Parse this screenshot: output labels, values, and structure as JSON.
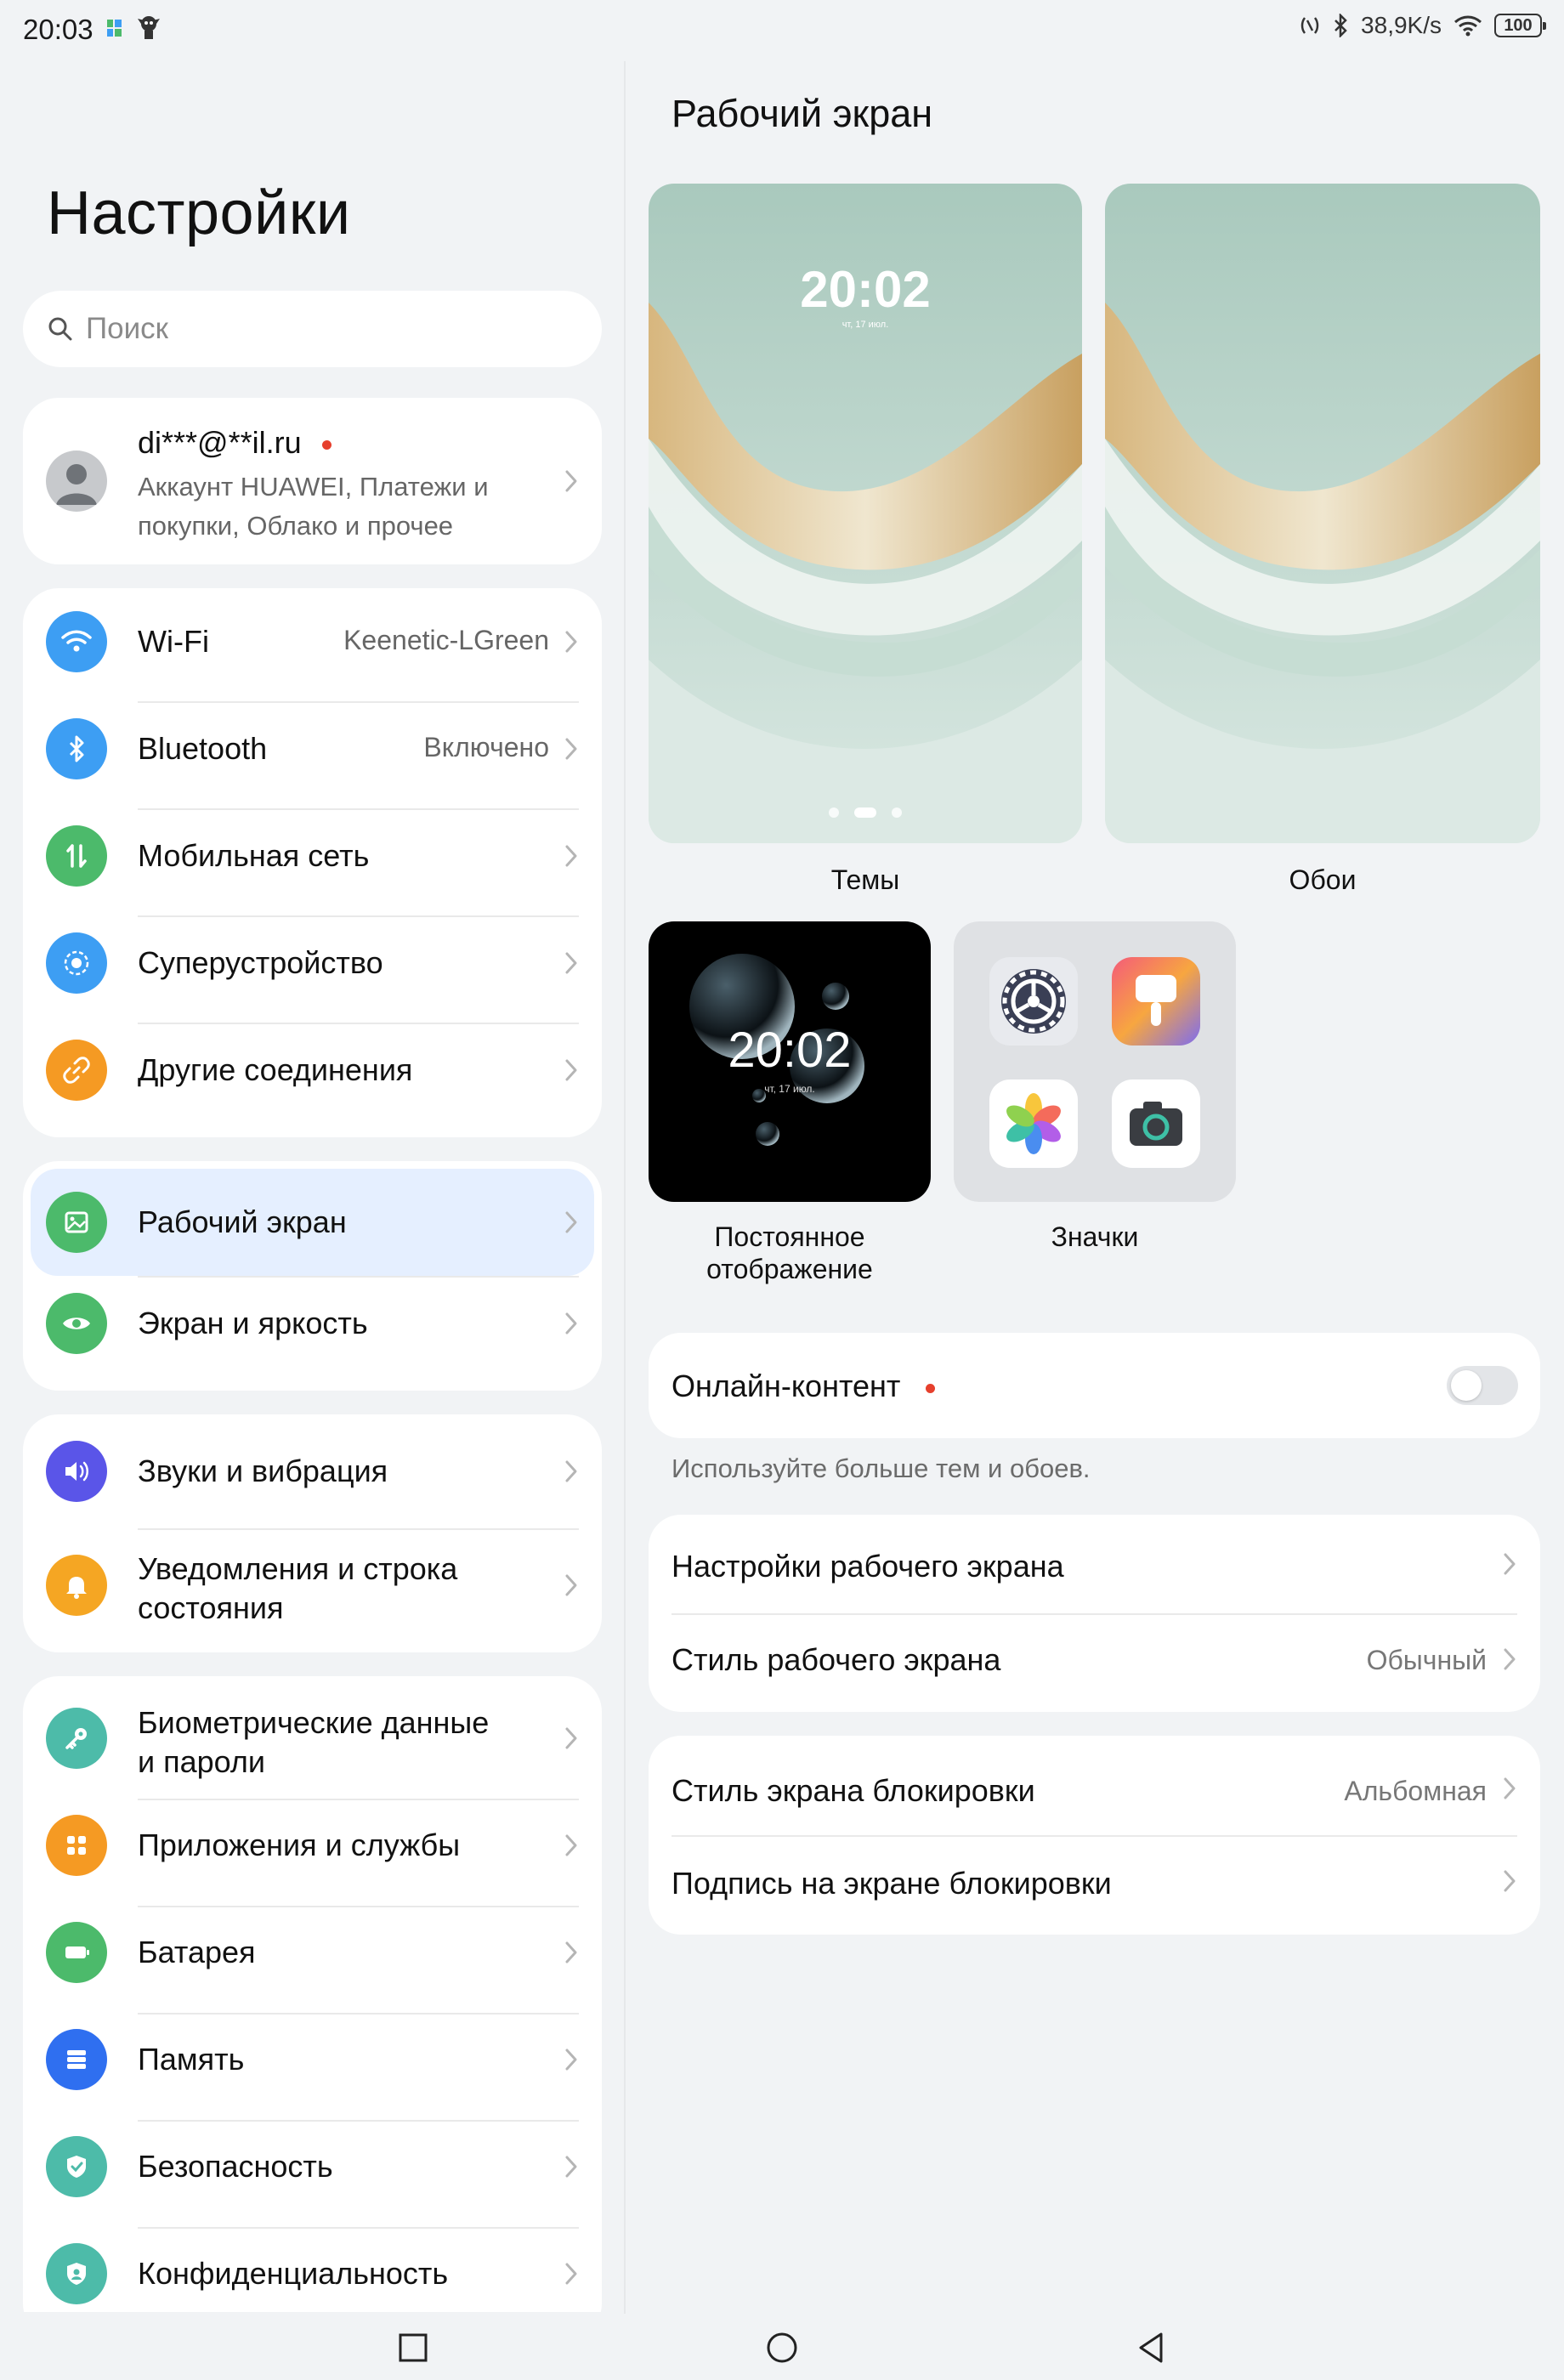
{
  "status_bar": {
    "time": "20:03",
    "net_speed": "38,9K/s",
    "battery": "100"
  },
  "left": {
    "title": "Настройки",
    "search_placeholder": "Поиск",
    "account": {
      "email": "di***@**il.ru",
      "subtitle": "Аккаунт HUAWEI, Платежи и покупки, Облако и прочее"
    },
    "group_connections": [
      {
        "label": "Wi-Fi",
        "value": "Keenetic-LGreen",
        "icon": "wifi-icon",
        "color": "#3d9ef3"
      },
      {
        "label": "Bluetooth",
        "value": "Включено",
        "icon": "bluetooth-icon",
        "color": "#3d9ef3"
      },
      {
        "label": "Мобильная сеть",
        "value": "",
        "icon": "mobile-network-icon",
        "color": "#4cba6b"
      },
      {
        "label": "Суперустройство",
        "value": "",
        "icon": "super-device-icon",
        "color": "#3d9ef3"
      },
      {
        "label": "Другие соединения",
        "value": "",
        "icon": "link-icon",
        "color": "#f59a23"
      }
    ],
    "group_display": [
      {
        "label": "Рабочий экран",
        "icon": "home-screen-icon",
        "color": "#4cba6b",
        "selected": true
      },
      {
        "label": "Экран и яркость",
        "icon": "eye-icon",
        "color": "#4cba6b",
        "selected": false
      }
    ],
    "group_sound": [
      {
        "label": "Звуки и вибрация",
        "icon": "sound-icon",
        "color": "#5a55e8"
      },
      {
        "label": "Уведомления и строка состояния",
        "icon": "bell-icon",
        "color": "#f5a623"
      }
    ],
    "group_system": [
      {
        "label": "Биометрические данные и пароли",
        "icon": "key-icon",
        "color": "#4dbba9"
      },
      {
        "label": "Приложения и службы",
        "icon": "apps-icon",
        "color": "#f59a23"
      },
      {
        "label": "Батарея",
        "icon": "battery-icon",
        "color": "#4cba6b"
      },
      {
        "label": "Память",
        "icon": "storage-icon",
        "color": "#2f6ff0"
      },
      {
        "label": "Безопасность",
        "icon": "shield-check-icon",
        "color": "#4dbba9"
      },
      {
        "label": "Конфиденциальность",
        "icon": "privacy-icon",
        "color": "#4dbba9"
      }
    ]
  },
  "right": {
    "title": "Рабочий экран",
    "themes": {
      "label": "Темы",
      "clock": "20:02",
      "date": "чт, 17 июл."
    },
    "wallpapers": {
      "label": "Обои"
    },
    "aod": {
      "label": "Постоянное отображение",
      "clock": "20:02",
      "date": "чт, 17 июл."
    },
    "icons": {
      "label": "Значки"
    },
    "online_content": {
      "label": "Онлайн-контент",
      "enabled": false,
      "note": "Используйте больше тем и обоев."
    },
    "settings_group1": [
      {
        "label": "Настройки рабочего экрана",
        "value": ""
      },
      {
        "label": "Стиль рабочего экрана",
        "value": "Обычный"
      }
    ],
    "settings_group2": [
      {
        "label": "Стиль экрана блокировки",
        "value": "Альбомная"
      },
      {
        "label": "Подпись на экране блокировки",
        "value": ""
      }
    ]
  },
  "colors": {
    "accent": "#007dff",
    "selected_bg": "#e5efff",
    "badge": "#e6402d",
    "background": "#f1f3f5"
  }
}
